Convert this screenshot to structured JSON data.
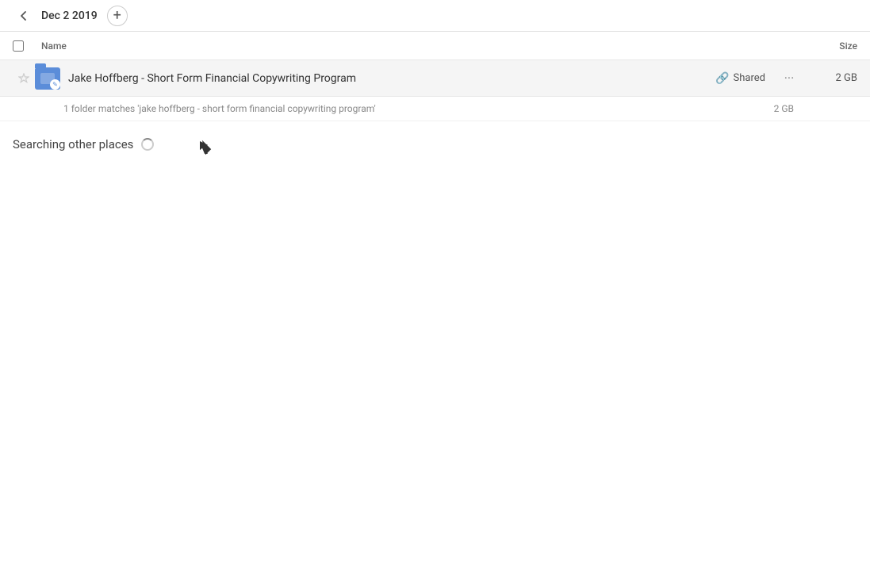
{
  "toolbar": {
    "back_icon": "◀",
    "breadcrumb": "Dec 2 2019",
    "add_icon": "+"
  },
  "columns": {
    "name_label": "Name",
    "size_label": "Size"
  },
  "file_row": {
    "name": "Jake Hoffberg - Short Form Financial Copywriting Program",
    "shared_label": "Shared",
    "size": "2 GB",
    "more_icon": "•••"
  },
  "match_info": {
    "text": "1 folder matches 'jake hoffberg - short form financial copywriting program'",
    "size": "2 GB"
  },
  "searching": {
    "label": "Searching other places"
  },
  "colors": {
    "folder_blue": "#5b8dd9",
    "accent": "#5b8dd9"
  }
}
